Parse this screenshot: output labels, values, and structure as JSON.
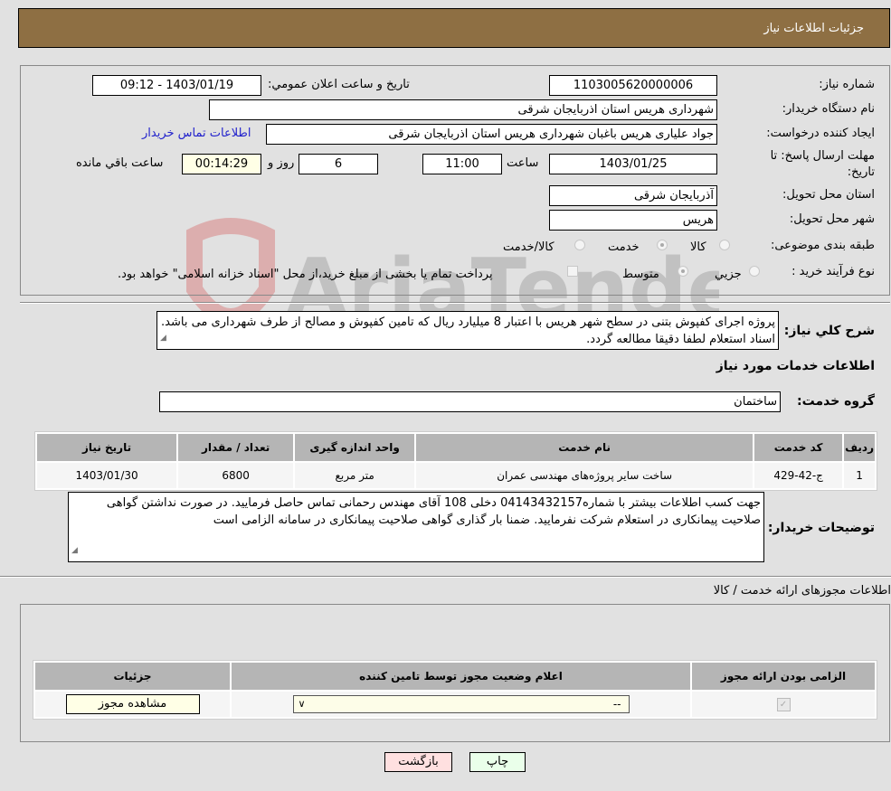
{
  "header": {
    "title": "جزئیات اطلاعات نیاز"
  },
  "form": {
    "need_number_label": "شماره نیاز:",
    "need_number": "1103005620000006",
    "announce_label": "تاریخ و ساعت اعلان عمومي:",
    "announce_value": "1403/01/19 - 09:12",
    "buyer_org_label": "نام دستگاه خریدار:",
    "buyer_org": "شهرداری هریس استان اذربایجان شرقی",
    "creator_label": "ایجاد کننده درخواست:",
    "creator": "جواد علیاری هریس باغبان شهرداری هریس استان اذربایجان شرقی",
    "contact_link": "اطلاعات تماس خریدار",
    "deadline_label_1": "مهلت ارسال پاسخ: تا",
    "deadline_label_2": "تاریخ:",
    "deadline_date": "1403/01/25",
    "time_label": "ساعت",
    "deadline_time": "11:00",
    "days": "6",
    "days_label": "روز و",
    "remaining": "00:14:29",
    "remaining_label": "ساعت باقي مانده",
    "province_label": "استان محل تحویل:",
    "province": "آذربایجان شرقی",
    "city_label": "شهر محل تحویل:",
    "city": "هریس",
    "category_label": "طبقه بندی موضوعی:",
    "category_options": [
      "کالا",
      "خدمت",
      "کالا/خدمت"
    ],
    "category_selected": "خدمت",
    "process_label": "نوع فرآیند خرید :",
    "process_options": [
      "جزيي",
      "متوسط"
    ],
    "process_selected": "متوسط",
    "treasury_text": "پرداخت تمام یا بخشی از مبلغ خرید،از محل \"اسناد خزانه اسلامی\" خواهد بود."
  },
  "summary": {
    "label": "شرح کلي نیاز:",
    "text": "پروژه اجرای کفپوش بتنی در سطح شهر هریس با اعتبار 8 میلیارد ریال که تامین کفپوش و مصالح از طرف شهرداری می باشد. اسناد استعلام لطفا دقیقا مطالعه گردد."
  },
  "services": {
    "title": "اطلاعات خدمات مورد نیاز",
    "group_label": "گروه خدمت:",
    "group_value": "ساختمان",
    "columns": [
      "ردیف",
      "کد خدمت",
      "نام خدمت",
      "واحد اندازه گیری",
      "تعداد / مقدار",
      "تاریخ نیاز"
    ],
    "rows": [
      [
        "1",
        "ج-42-429",
        "ساخت سایر پروژه‌های مهندسی عمران",
        "متر مربع",
        "6800",
        "1403/01/30"
      ]
    ]
  },
  "buyer_notes": {
    "label": "توضیحات خریدار:",
    "text": "جهت کسب اطلاعات بیشتر با شماره04143432157 دخلی 108 آقای مهندس رحمانی تماس حاصل فرمایید. در صورت نداشتن گواهی صلاحیت پیمانکاری در استعلام شرکت نفرمایید. ضمنا بار گذاری گواهی صلاحیت پیمانکاری در سامانه الزامی است"
  },
  "permits": {
    "title": "اطلاعات مجوزهای ارائه خدمت / کالا",
    "columns": [
      "الزامی بودن ارائه مجوز",
      "اعلام وضعیت مجوز توسط تامین کننده",
      "جزئیات"
    ],
    "row": {
      "required_checked": true,
      "status_value": "--",
      "view_button": "مشاهده مجوز"
    }
  },
  "actions": {
    "print": "چاپ",
    "back": "بازگشت"
  }
}
